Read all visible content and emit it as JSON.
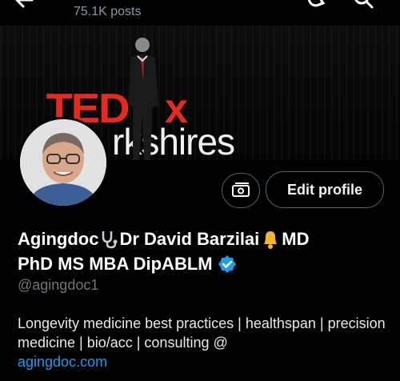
{
  "header": {
    "posts": "75.1K posts",
    "icons": [
      "back-arrow-icon",
      "topic-icon",
      "search-icon"
    ]
  },
  "banner": {
    "logo_ted": "TED",
    "logo_x": "x",
    "event_name": "rkshires",
    "logo_color": "#e62b1e"
  },
  "actions": {
    "edit_profile": "Edit profile"
  },
  "profile": {
    "name_part1": "Agingdoc",
    "name_part2": "Dr David Barzilai",
    "name_part3": "MD",
    "name_line2": "PhD MS MBA DipABLM",
    "handle": "@agingdoc1",
    "bio_text": "Longevity medicine best practices | healthspan | precision medicine | bio/acc  | consulting @",
    "bio_link": "agingdoc.com",
    "verified_color": "#1d9bf0"
  }
}
